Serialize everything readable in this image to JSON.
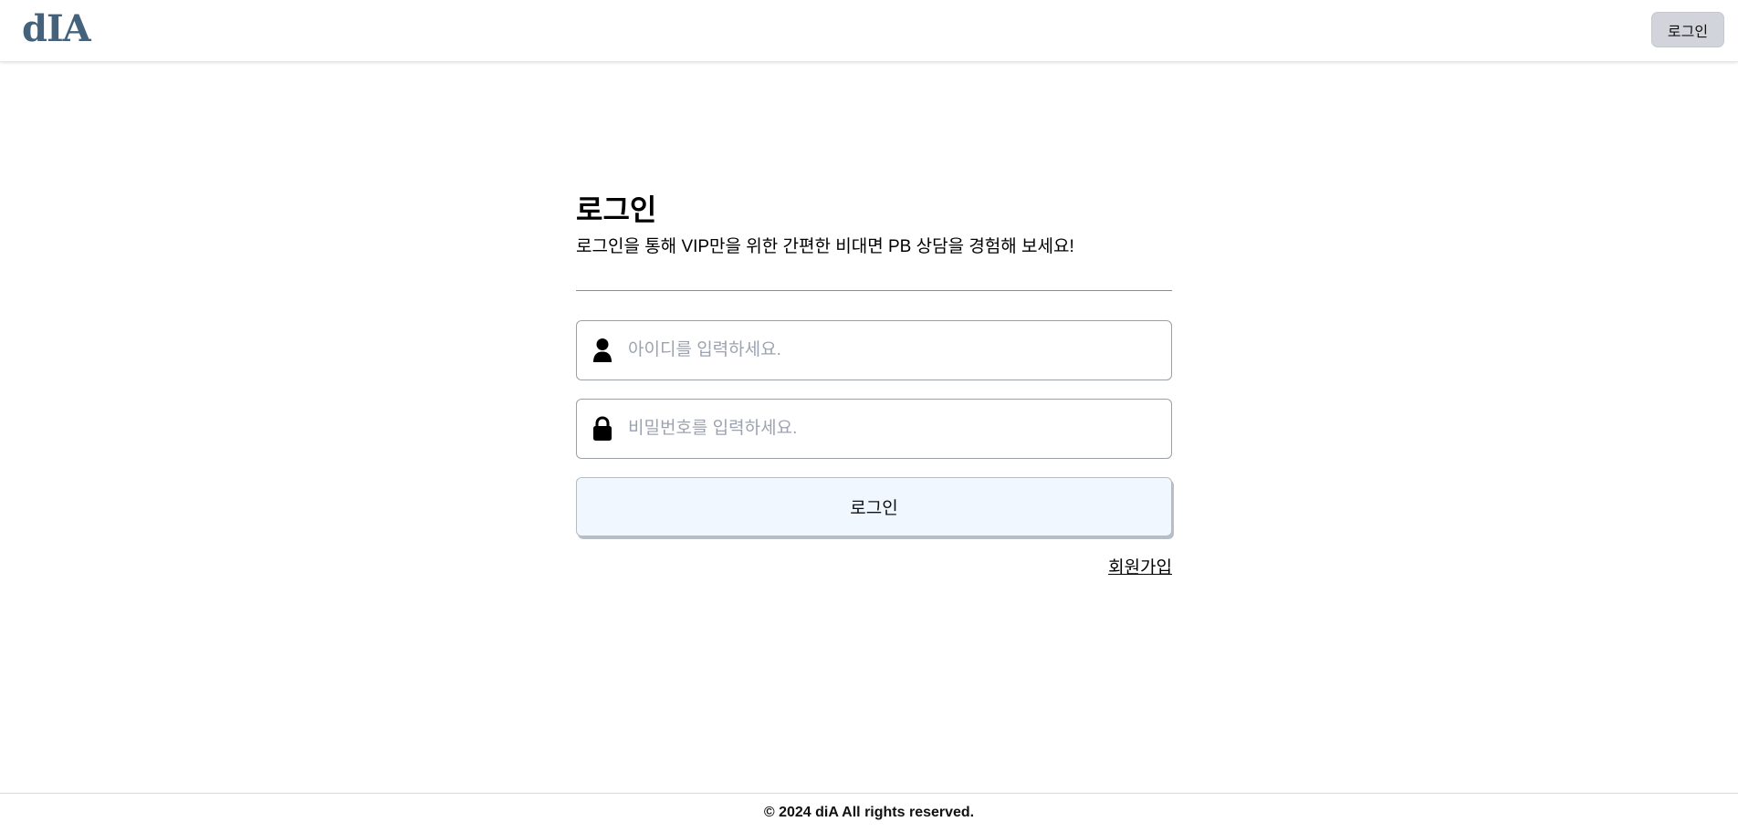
{
  "header": {
    "logo_text": "dIA",
    "login_label": "로그인"
  },
  "main": {
    "title": "로그인",
    "subtitle": "로그인을 통해 VIP만을 위한 간편한 비대면 PB 상담을 경험해 보세요!",
    "id_field": {
      "placeholder": "아이디를 입력하세요.",
      "value": "",
      "icon": "user-icon"
    },
    "password_field": {
      "placeholder": "비밀번호를 입력하세요.",
      "value": "",
      "icon": "lock-icon"
    },
    "login_button_label": "로그인",
    "signup_label": "회원가입"
  },
  "footer": {
    "copyright": "© 2024 diA All rights reserved."
  },
  "colors": {
    "logo": "#44627c",
    "header_button_bg": "#d1d5db",
    "login_button_bg": "#f0f7ff",
    "placeholder": "#9ca3af"
  }
}
